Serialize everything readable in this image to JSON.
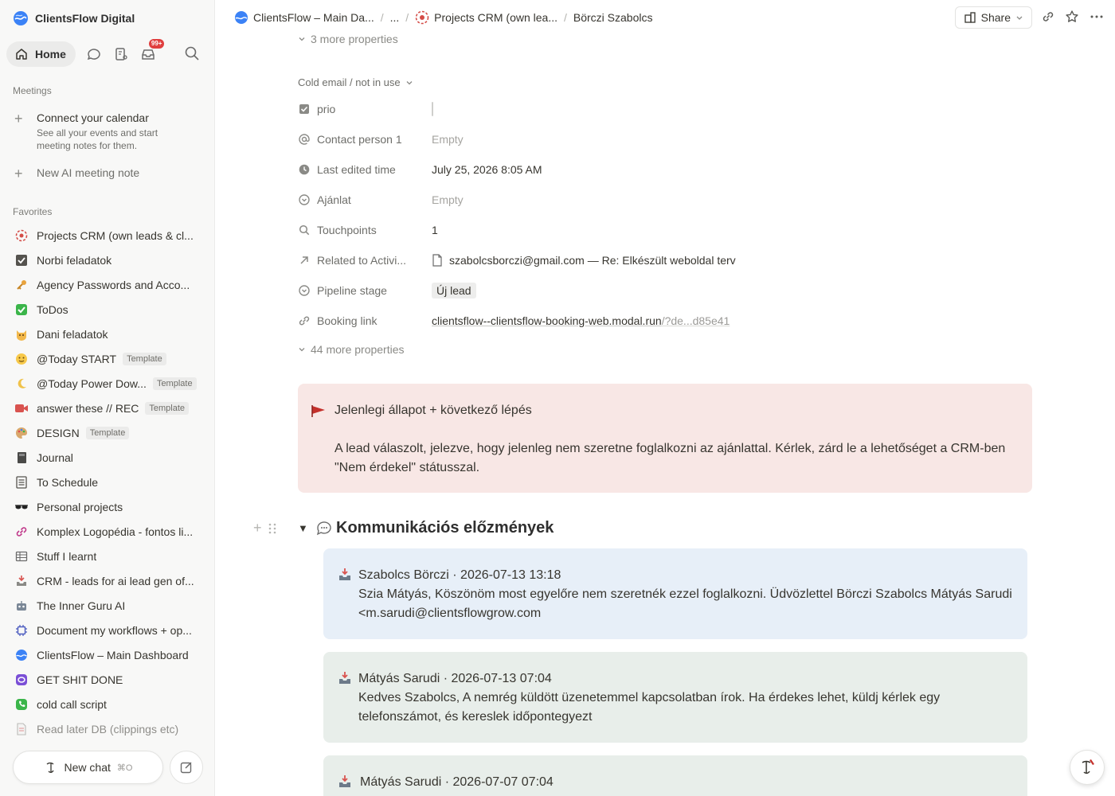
{
  "workspace": {
    "name": "ClientsFlow Digital"
  },
  "nav": {
    "home_label": "Home",
    "inbox_badge": "99+"
  },
  "meetings": {
    "section_label": "Meetings",
    "connect_title": "Connect your calendar",
    "connect_sub": "See all your events and start meeting notes for them.",
    "new_note": "New AI meeting note"
  },
  "favorites": {
    "section_label": "Favorites",
    "items": [
      {
        "label": "Projects CRM (own leads & cl...",
        "icon": "target-icon",
        "template": ""
      },
      {
        "label": "Norbi feladatok",
        "icon": "checkbox-icon",
        "template": ""
      },
      {
        "label": "Agency Passwords and Acco...",
        "icon": "key-icon",
        "template": ""
      },
      {
        "label": "ToDos",
        "icon": "check-mark-icon",
        "template": ""
      },
      {
        "label": "Dani feladatok",
        "icon": "cat-icon",
        "template": ""
      },
      {
        "label": "@Today START",
        "icon": "smile-icon",
        "template": "Template"
      },
      {
        "label": "@Today Power Dow...",
        "icon": "moon-icon",
        "template": "Template"
      },
      {
        "label": "answer these // REC",
        "icon": "video-camera-icon",
        "template": "Template"
      },
      {
        "label": "DESIGN",
        "icon": "palette-icon",
        "template": "Template"
      },
      {
        "label": "Journal",
        "icon": "notebook-icon",
        "template": ""
      },
      {
        "label": "To Schedule",
        "icon": "list-icon",
        "template": ""
      },
      {
        "label": "Personal projects",
        "icon": "sunglasses-icon",
        "template": ""
      },
      {
        "label": "Komplex Logopédia - fontos li...",
        "icon": "link-icon",
        "template": ""
      },
      {
        "label": "Stuff I learnt",
        "icon": "table-icon",
        "template": ""
      },
      {
        "label": "CRM - leads for ai lead gen of...",
        "icon": "inbox-tray-icon",
        "template": ""
      },
      {
        "label": "The Inner Guru AI",
        "icon": "robot-icon",
        "template": ""
      },
      {
        "label": "Document my workflows + op...",
        "icon": "chip-icon",
        "template": ""
      },
      {
        "label": "ClientsFlow – Main Dashboard",
        "icon": "globe-icon",
        "template": ""
      },
      {
        "label": "GET SHIT DONE",
        "icon": "purple-app-icon",
        "template": ""
      },
      {
        "label": "cold call script",
        "icon": "phone-icon",
        "template": ""
      },
      {
        "label": "Read later DB (clippings etc)",
        "icon": "document-icon",
        "template": ""
      }
    ]
  },
  "bottom": {
    "new_chat": "New chat",
    "new_chat_shortcut": "⌘O"
  },
  "breadcrumb": {
    "items": [
      "ClientsFlow – Main Da...",
      "...",
      "Projects CRM (own lea...",
      "Börczi Szabolcs"
    ]
  },
  "topbar": {
    "share_label": "Share"
  },
  "properties": {
    "more_top": "3 more properties",
    "group_label": "Cold email / not in use",
    "rows": [
      {
        "icon": "checkbox-icon",
        "name": "prio",
        "value": "",
        "kind": "checkbox"
      },
      {
        "icon": "at-icon",
        "name": "Contact person 1",
        "value": "Empty",
        "kind": "empty"
      },
      {
        "icon": "clock-icon",
        "name": "Last edited time",
        "value": "July 25, 2026 8:05 AM",
        "kind": "text"
      },
      {
        "icon": "chevron-circle-icon",
        "name": "Ajánlat",
        "value": "Empty",
        "kind": "empty"
      },
      {
        "icon": "search-icon",
        "name": "Touchpoints",
        "value": "1",
        "kind": "text"
      },
      {
        "icon": "arrow-up-right-icon",
        "name": "Related to Activi...",
        "value": "szabolcsborczi@gmail.com — Re: Elkészült weboldal terv",
        "kind": "relation"
      },
      {
        "icon": "chevron-circle-icon",
        "name": "Pipeline stage",
        "value": "Új lead",
        "kind": "tag"
      },
      {
        "icon": "link-icon",
        "name": "Booking link",
        "value": "clientsflow--clientsflow-booking-web.modal.run",
        "value_rest": "/?de...d85e41",
        "kind": "link"
      }
    ],
    "more_bottom": "44 more properties"
  },
  "callout": {
    "icon": "red-flag-icon",
    "title": "Jelenlegi állapot + következő lépés",
    "body": "A lead válaszolt, jelezve, hogy jelenleg nem szeretne foglalkozni az ajánlattal. Kérlek, zárd le a lehetőséget a CRM-ben \"Nem érdekel\" státusszal."
  },
  "history": {
    "heading": "Kommunikációs előzmények",
    "heading_icon": "speech-bubble-icon",
    "messages": [
      {
        "header": "Szabolcs Börczi · 2026-07-13 13:18",
        "body": "Szia Mátyás, Köszönöm most egyelőre nem szeretnék ezzel foglalkozni. Üdvözlettel Börczi Szabolcs Mátyás Sarudi <m.sarudi@clientsflowgrow.com",
        "color": "#e7eff8"
      },
      {
        "header": "Mátyás Sarudi · 2026-07-13 07:04",
        "body": "Kedves Szabolcs, A nemrég küldött üzenetemmel kapcsolatban írok. Ha érdekes lehet, küldj kérlek egy telefonszámot, és kereslek időpontegyezt",
        "color": "#e8eeea"
      },
      {
        "header": "Mátyás Sarudi · 2026-07-07 07:04",
        "body": "",
        "color": "#e8eeea"
      }
    ]
  }
}
